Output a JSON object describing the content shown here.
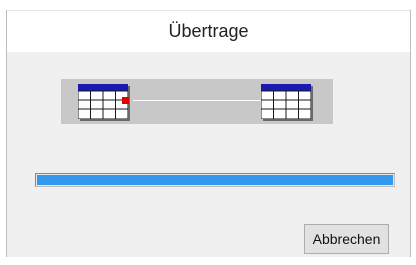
{
  "dialog": {
    "title": "Übertrage",
    "cancel_label": "Abbrechen"
  },
  "progress": {
    "fraction": 1.0,
    "fill_color": "#3399ee"
  },
  "animation": {
    "source_icon": "table-icon",
    "target_icon": "table-icon",
    "indicator_color": "#e00000"
  }
}
